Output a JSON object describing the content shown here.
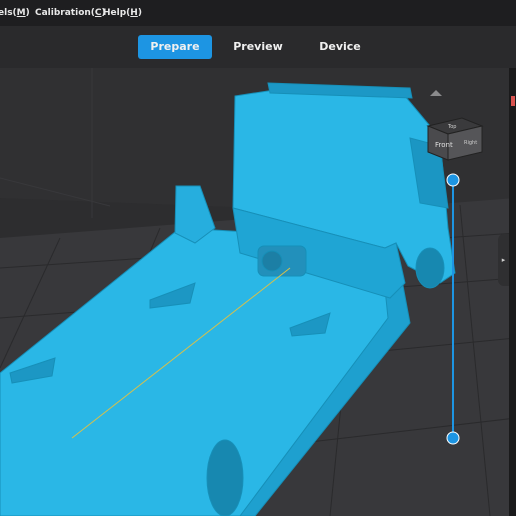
{
  "menubar": {
    "items": [
      {
        "label": "els(M)"
      },
      {
        "label": "Calibration(C)"
      },
      {
        "label": "Help(H)"
      }
    ]
  },
  "tabs": [
    {
      "label": "Prepare",
      "active": true
    },
    {
      "label": "Preview",
      "active": false
    },
    {
      "label": "Device",
      "active": false
    }
  ],
  "viewport": {
    "view_cube": {
      "top_label": "Top",
      "front_label": "Front",
      "right_label": "Right"
    },
    "model_color": "#2ab7e6"
  },
  "colors": {
    "accent": "#1d95e3",
    "model": "#2ab7e6",
    "background": "#2c2c2e",
    "menubar": "#1e1e20"
  }
}
